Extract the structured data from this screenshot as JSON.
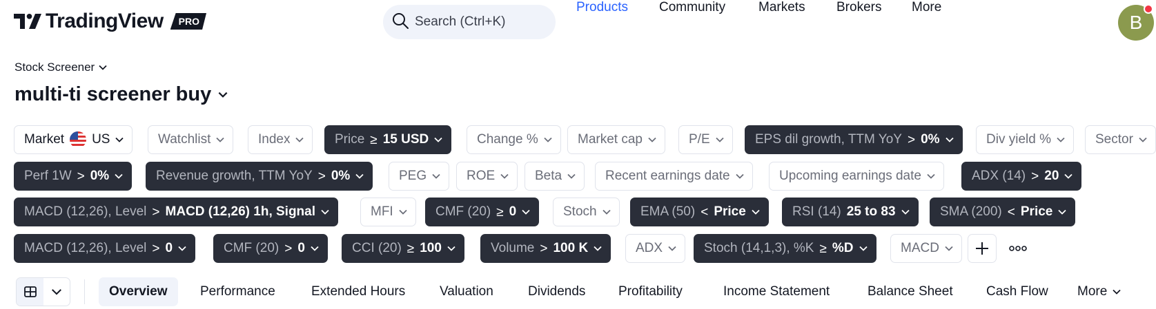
{
  "header": {
    "logo_text": "TradingView",
    "pro_badge": "PRO",
    "search_placeholder": "Search (Ctrl+K)",
    "nav": [
      "Products",
      "Community",
      "Markets",
      "Brokers",
      "More"
    ],
    "avatar_letter": "B",
    "colors": {
      "active_nav": "#2962ff",
      "avatar_bg": "#8b9a4e",
      "notification_dot": "#f23645"
    }
  },
  "screener": {
    "type_label": "Stock Screener",
    "title": "multi-ti screener buy"
  },
  "filters": {
    "market_label": "Market",
    "market_value": "US",
    "watchlist": "Watchlist",
    "index": "Index",
    "price_label": "Price",
    "price_op": "≥",
    "price_value": "15 USD",
    "change": "Change %",
    "market_cap": "Market cap",
    "pe": "P/E",
    "eps_label": "EPS dil growth, TTM YoY",
    "eps_op": ">",
    "eps_value": "0%",
    "div_yield": "Div yield %",
    "sector": "Sector",
    "perf_label": "Perf 1W",
    "perf_op": ">",
    "perf_value": "0%",
    "rev_label": "Revenue growth, TTM YoY",
    "rev_op": ">",
    "rev_value": "0%",
    "peg": "PEG",
    "roe": "ROE",
    "beta": "Beta",
    "recent_earnings": "Recent earnings date",
    "upcoming_earnings": "Upcoming earnings date",
    "adx14_label": "ADX (14)",
    "adx14_op": ">",
    "adx14_value": "20",
    "macd1_label": "MACD (12,26), Level",
    "macd1_op": ">",
    "macd1_value": "MACD (12,26) 1h, Signal",
    "mfi": "MFI",
    "cmf1_label": "CMF (20)",
    "cmf1_op": "≥",
    "cmf1_value": "0",
    "stoch": "Stoch",
    "ema_label": "EMA (50)",
    "ema_op": "<",
    "ema_value": "Price",
    "rsi_label": "RSI (14)",
    "rsi_value": "25 to 83",
    "sma_label": "SMA (200)",
    "sma_op": "<",
    "sma_value": "Price",
    "macd2_label": "MACD (12,26), Level",
    "macd2_op": ">",
    "macd2_value": "0",
    "cmf2_label": "CMF (20)",
    "cmf2_op": ">",
    "cmf2_value": "0",
    "cci_label": "CCI (20)",
    "cci_op": "≥",
    "cci_value": "100",
    "volume_label": "Volume",
    "volume_op": ">",
    "volume_value": "100 K",
    "adx": "ADX",
    "stochk_label": "Stoch (14,1,3), %K",
    "stochk_op": "≥",
    "stochk_value": "%D",
    "macd": "MACD",
    "colors": {
      "active_chip_bg": "#2a2e39"
    }
  },
  "tabs": [
    "Overview",
    "Performance",
    "Extended Hours",
    "Valuation",
    "Dividends",
    "Profitability",
    "Income Statement",
    "Balance Sheet",
    "Cash Flow",
    "More"
  ]
}
